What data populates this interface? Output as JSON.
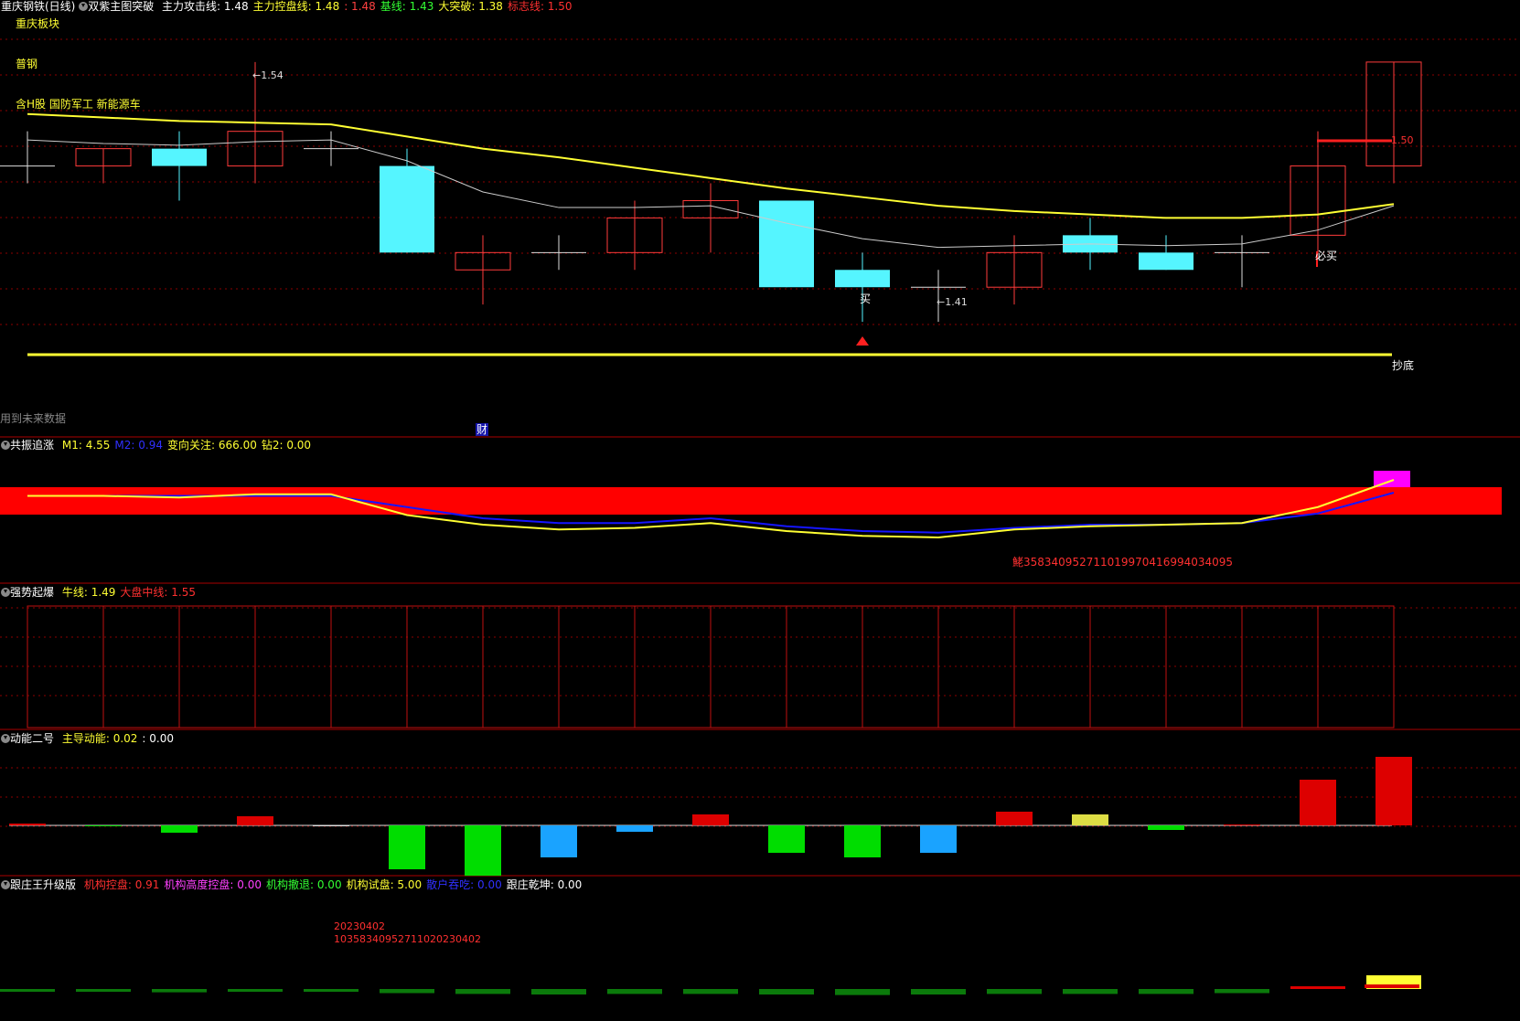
{
  "colors": {
    "up": "#ff3b3b",
    "down": "#55f5ff",
    "yellow": "#ffff33",
    "white": "#dddddd",
    "grid": "#8b0000",
    "blue": "#1515ff",
    "magenta": "#ff00ff",
    "green": "#00dd00",
    "bar_blue": "#1aa3ff",
    "bar_red": "#dd0000",
    "bar_yellow": "#dddd44",
    "dkgreen": "#0b7a0b"
  },
  "header": {
    "title": "重庆钢铁(日线)",
    "indicator": "双紫主图突破",
    "items": [
      {
        "label": "主力攻击线:",
        "value": "1.48",
        "color": "#ffffff"
      },
      {
        "label": "主力控盘线:",
        "value": "1.48",
        "color": "#ffff33"
      },
      {
        "label": ":",
        "value": "1.48",
        "color": "#ff4040"
      },
      {
        "label": "基线:",
        "value": "1.43",
        "color": "#33ff33"
      },
      {
        "label": "大突破:",
        "value": "1.38",
        "color": "#ffff33"
      },
      {
        "label": "标志线:",
        "value": "1.50",
        "color": "#ff3030"
      }
    ]
  },
  "tags": {
    "sector": "重庆板块",
    "industry": "普钢",
    "concepts": "含H股 国防军工 新能源车"
  },
  "annotations": {
    "high": "1.54",
    "low": "1.41",
    "buy": "买",
    "must_buy": "必买",
    "chaodi": "抄底",
    "last_val": "1.50",
    "future": "用到未来数据",
    "cai": "财"
  },
  "panel2": {
    "title": "共振追涨",
    "items": [
      {
        "label": "M1:",
        "value": "4.55",
        "color": "#ffff33"
      },
      {
        "label": "M2:",
        "value": "0.94",
        "color": "#3030ff"
      },
      {
        "label": "变向关注:",
        "value": "666.00",
        "color": "#ffff33"
      },
      {
        "label": "钻2:",
        "value": "0.00",
        "color": "#ffff33"
      }
    ],
    "note": "鮱3583409527110199704169940340​95"
  },
  "panel3": {
    "title": "强势起爆",
    "items": [
      {
        "label": "牛线:",
        "value": "1.49",
        "color": "#ffff33"
      },
      {
        "label": "大盘中线:",
        "value": "1.55",
        "color": "#ff3030"
      }
    ]
  },
  "panel4": {
    "title": "动能二号",
    "items": [
      {
        "label": "主导动能:",
        "value": "0.02",
        "color": "#ffff33"
      },
      {
        "label": ":",
        "value": "0.00",
        "color": "#ffffff"
      }
    ]
  },
  "panel5": {
    "title": "跟庄王升级版",
    "items": [
      {
        "label": "机构控盘:",
        "value": "0.91",
        "color": "#ff3030"
      },
      {
        "label": "机构高度控盘:",
        "value": "0.00",
        "color": "#ff40ff"
      },
      {
        "label": "机构撤退:",
        "value": "0.00",
        "color": "#33ff33"
      },
      {
        "label": "机构试盘:",
        "value": "5.00",
        "color": "#ffff33"
      },
      {
        "label": "散户吞吃:",
        "value": "0.00",
        "color": "#3030ff"
      },
      {
        "label": "跟庄乾坤:",
        "value": "0.00",
        "color": "#ffffff"
      }
    ],
    "note1": "20230402",
    "note2": "10358340952711020230402"
  },
  "chart_data": [
    {
      "type": "candlestick",
      "title": "重庆钢铁(日线)",
      "candles": [
        {
          "o": 1.48,
          "h": 1.5,
          "l": 1.47,
          "c": 1.48
        },
        {
          "o": 1.48,
          "h": 1.49,
          "l": 1.47,
          "c": 1.49
        },
        {
          "o": 1.49,
          "h": 1.5,
          "l": 1.46,
          "c": 1.48
        },
        {
          "o": 1.48,
          "h": 1.54,
          "l": 1.47,
          "c": 1.5
        },
        {
          "o": 1.49,
          "h": 1.5,
          "l": 1.48,
          "c": 1.49
        },
        {
          "o": 1.48,
          "h": 1.49,
          "l": 1.43,
          "c": 1.43
        },
        {
          "o": 1.42,
          "h": 1.44,
          "l": 1.4,
          "c": 1.43
        },
        {
          "o": 1.43,
          "h": 1.44,
          "l": 1.42,
          "c": 1.43
        },
        {
          "o": 1.43,
          "h": 1.46,
          "l": 1.42,
          "c": 1.45
        },
        {
          "o": 1.45,
          "h": 1.47,
          "l": 1.43,
          "c": 1.46
        },
        {
          "o": 1.46,
          "h": 1.46,
          "l": 1.41,
          "c": 1.41
        },
        {
          "o": 1.42,
          "h": 1.43,
          "l": 1.39,
          "c": 1.41
        },
        {
          "o": 1.41,
          "h": 1.42,
          "l": 1.39,
          "c": 1.41
        },
        {
          "o": 1.41,
          "h": 1.44,
          "l": 1.4,
          "c": 1.43
        },
        {
          "o": 1.44,
          "h": 1.45,
          "l": 1.42,
          "c": 1.43
        },
        {
          "o": 1.43,
          "h": 1.44,
          "l": 1.42,
          "c": 1.42
        },
        {
          "o": 1.43,
          "h": 1.44,
          "l": 1.41,
          "c": 1.43
        },
        {
          "o": 1.44,
          "h": 1.5,
          "l": 1.43,
          "c": 1.48
        },
        {
          "o": 1.48,
          "h": 1.54,
          "l": 1.47,
          "c": 1.54
        }
      ],
      "ma_yellow": [
        1.51,
        1.508,
        1.506,
        1.505,
        1.504,
        1.497,
        1.49,
        1.485,
        1.479,
        1.473,
        1.467,
        1.462,
        1.457,
        1.454,
        1.452,
        1.45,
        1.45,
        1.452,
        1.458
      ],
      "ma_white": [
        1.495,
        1.493,
        1.492,
        1.494,
        1.495,
        1.483,
        1.465,
        1.456,
        1.456,
        1.457,
        1.447,
        1.438,
        1.433,
        1.434,
        1.435,
        1.434,
        1.435,
        1.443,
        1.457
      ],
      "ylim": [
        1.37,
        1.56
      ]
    },
    {
      "type": "line",
      "title": "共振追涨",
      "series": [
        {
          "name": "M1",
          "values": [
            5.0,
            5.0,
            4.9,
            5.1,
            5.1,
            3.8,
            3.2,
            2.9,
            3.0,
            3.3,
            2.8,
            2.5,
            2.4,
            2.9,
            3.1,
            3.2,
            3.3,
            4.3,
            6.0
          ]
        },
        {
          "name": "M2",
          "values": [
            5.0,
            5.0,
            5.0,
            5.0,
            5.0,
            4.3,
            3.6,
            3.3,
            3.3,
            3.6,
            3.1,
            2.8,
            2.7,
            3.0,
            3.2,
            3.2,
            3.3,
            3.9,
            5.2
          ]
        }
      ],
      "ylim": [
        0,
        8
      ]
    },
    {
      "type": "bar",
      "title": "动能二号",
      "values": [
        0.02,
        -0.01,
        -0.08,
        0.1,
        -0.01,
        -0.48,
        -0.55,
        -0.35,
        -0.07,
        0.12,
        -0.3,
        -0.35,
        -0.3,
        0.15,
        0.12,
        -0.05,
        0.01,
        0.5,
        0.75
      ],
      "ylim": [
        -0.6,
        0.8
      ]
    },
    {
      "type": "bar",
      "title": "跟庄王升级版",
      "values": [
        -0.1,
        -0.1,
        -0.12,
        -0.1,
        -0.1,
        -0.15,
        -0.18,
        -0.2,
        -0.18,
        -0.18,
        -0.2,
        -0.22,
        -0.2,
        -0.18,
        -0.18,
        -0.18,
        -0.15,
        0.1,
        0.5
      ],
      "ylim": [
        -1,
        1
      ]
    }
  ]
}
